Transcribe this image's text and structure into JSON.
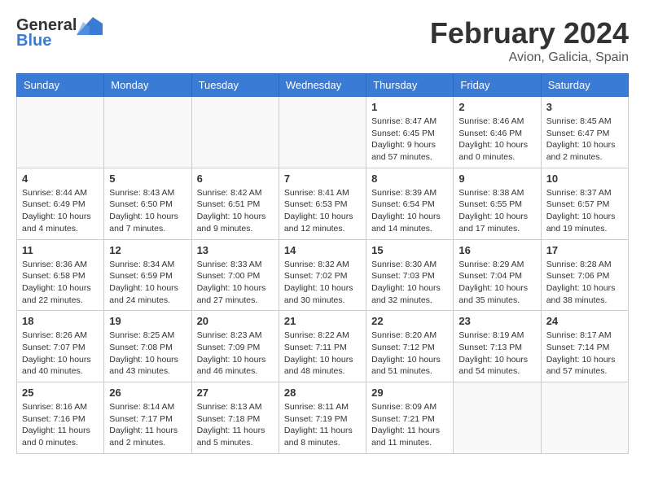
{
  "header": {
    "logo_general": "General",
    "logo_blue": "Blue",
    "month_title": "February 2024",
    "location": "Avion, Galicia, Spain"
  },
  "calendar": {
    "days_of_week": [
      "Sunday",
      "Monday",
      "Tuesday",
      "Wednesday",
      "Thursday",
      "Friday",
      "Saturday"
    ],
    "weeks": [
      {
        "days": [
          {
            "number": "",
            "info": ""
          },
          {
            "number": "",
            "info": ""
          },
          {
            "number": "",
            "info": ""
          },
          {
            "number": "",
            "info": ""
          },
          {
            "number": "1",
            "info": "Sunrise: 8:47 AM\nSunset: 6:45 PM\nDaylight: 9 hours\nand 57 minutes."
          },
          {
            "number": "2",
            "info": "Sunrise: 8:46 AM\nSunset: 6:46 PM\nDaylight: 10 hours\nand 0 minutes."
          },
          {
            "number": "3",
            "info": "Sunrise: 8:45 AM\nSunset: 6:47 PM\nDaylight: 10 hours\nand 2 minutes."
          }
        ]
      },
      {
        "days": [
          {
            "number": "4",
            "info": "Sunrise: 8:44 AM\nSunset: 6:49 PM\nDaylight: 10 hours\nand 4 minutes."
          },
          {
            "number": "5",
            "info": "Sunrise: 8:43 AM\nSunset: 6:50 PM\nDaylight: 10 hours\nand 7 minutes."
          },
          {
            "number": "6",
            "info": "Sunrise: 8:42 AM\nSunset: 6:51 PM\nDaylight: 10 hours\nand 9 minutes."
          },
          {
            "number": "7",
            "info": "Sunrise: 8:41 AM\nSunset: 6:53 PM\nDaylight: 10 hours\nand 12 minutes."
          },
          {
            "number": "8",
            "info": "Sunrise: 8:39 AM\nSunset: 6:54 PM\nDaylight: 10 hours\nand 14 minutes."
          },
          {
            "number": "9",
            "info": "Sunrise: 8:38 AM\nSunset: 6:55 PM\nDaylight: 10 hours\nand 17 minutes."
          },
          {
            "number": "10",
            "info": "Sunrise: 8:37 AM\nSunset: 6:57 PM\nDaylight: 10 hours\nand 19 minutes."
          }
        ]
      },
      {
        "days": [
          {
            "number": "11",
            "info": "Sunrise: 8:36 AM\nSunset: 6:58 PM\nDaylight: 10 hours\nand 22 minutes."
          },
          {
            "number": "12",
            "info": "Sunrise: 8:34 AM\nSunset: 6:59 PM\nDaylight: 10 hours\nand 24 minutes."
          },
          {
            "number": "13",
            "info": "Sunrise: 8:33 AM\nSunset: 7:00 PM\nDaylight: 10 hours\nand 27 minutes."
          },
          {
            "number": "14",
            "info": "Sunrise: 8:32 AM\nSunset: 7:02 PM\nDaylight: 10 hours\nand 30 minutes."
          },
          {
            "number": "15",
            "info": "Sunrise: 8:30 AM\nSunset: 7:03 PM\nDaylight: 10 hours\nand 32 minutes."
          },
          {
            "number": "16",
            "info": "Sunrise: 8:29 AM\nSunset: 7:04 PM\nDaylight: 10 hours\nand 35 minutes."
          },
          {
            "number": "17",
            "info": "Sunrise: 8:28 AM\nSunset: 7:06 PM\nDaylight: 10 hours\nand 38 minutes."
          }
        ]
      },
      {
        "days": [
          {
            "number": "18",
            "info": "Sunrise: 8:26 AM\nSunset: 7:07 PM\nDaylight: 10 hours\nand 40 minutes."
          },
          {
            "number": "19",
            "info": "Sunrise: 8:25 AM\nSunset: 7:08 PM\nDaylight: 10 hours\nand 43 minutes."
          },
          {
            "number": "20",
            "info": "Sunrise: 8:23 AM\nSunset: 7:09 PM\nDaylight: 10 hours\nand 46 minutes."
          },
          {
            "number": "21",
            "info": "Sunrise: 8:22 AM\nSunset: 7:11 PM\nDaylight: 10 hours\nand 48 minutes."
          },
          {
            "number": "22",
            "info": "Sunrise: 8:20 AM\nSunset: 7:12 PM\nDaylight: 10 hours\nand 51 minutes."
          },
          {
            "number": "23",
            "info": "Sunrise: 8:19 AM\nSunset: 7:13 PM\nDaylight: 10 hours\nand 54 minutes."
          },
          {
            "number": "24",
            "info": "Sunrise: 8:17 AM\nSunset: 7:14 PM\nDaylight: 10 hours\nand 57 minutes."
          }
        ]
      },
      {
        "days": [
          {
            "number": "25",
            "info": "Sunrise: 8:16 AM\nSunset: 7:16 PM\nDaylight: 11 hours\nand 0 minutes."
          },
          {
            "number": "26",
            "info": "Sunrise: 8:14 AM\nSunset: 7:17 PM\nDaylight: 11 hours\nand 2 minutes."
          },
          {
            "number": "27",
            "info": "Sunrise: 8:13 AM\nSunset: 7:18 PM\nDaylight: 11 hours\nand 5 minutes."
          },
          {
            "number": "28",
            "info": "Sunrise: 8:11 AM\nSunset: 7:19 PM\nDaylight: 11 hours\nand 8 minutes."
          },
          {
            "number": "29",
            "info": "Sunrise: 8:09 AM\nSunset: 7:21 PM\nDaylight: 11 hours\nand 11 minutes."
          },
          {
            "number": "",
            "info": ""
          },
          {
            "number": "",
            "info": ""
          }
        ]
      }
    ]
  }
}
